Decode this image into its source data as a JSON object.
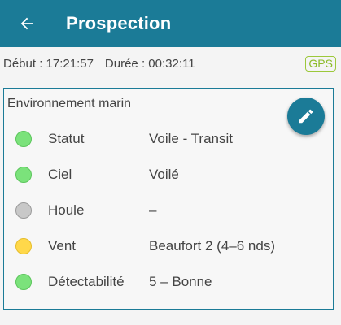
{
  "header": {
    "title": "Prospection",
    "back_icon": "arrow-left-icon"
  },
  "info": {
    "start": "Début : 17:21:57",
    "duration": "Durée : 00:32:11",
    "gps": "GPS"
  },
  "card": {
    "title": "Environnement marin",
    "edit_icon": "pencil-icon",
    "rows": [
      {
        "label": "Statut",
        "value": "Voile - Transit",
        "status_color": "#7be27b",
        "status_border": "#5cc65c"
      },
      {
        "label": "Ciel",
        "value": "Voilé",
        "status_color": "#7be27b",
        "status_border": "#5cc65c"
      },
      {
        "label": "Houle",
        "value": "–",
        "status_color": "#c8c8c8",
        "status_border": "#9a9a9a"
      },
      {
        "label": "Vent",
        "value": "Beaufort 2 (4–6 nds)",
        "status_color": "#ffd84a",
        "status_border": "#e6bd2a"
      },
      {
        "label": "Détectabilité",
        "value": "5 – Bonne",
        "status_color": "#7be27b",
        "status_border": "#5cc65c"
      }
    ]
  },
  "colors": {
    "primary": "#1b7b97",
    "gps_accent": "#8dbc2a"
  }
}
